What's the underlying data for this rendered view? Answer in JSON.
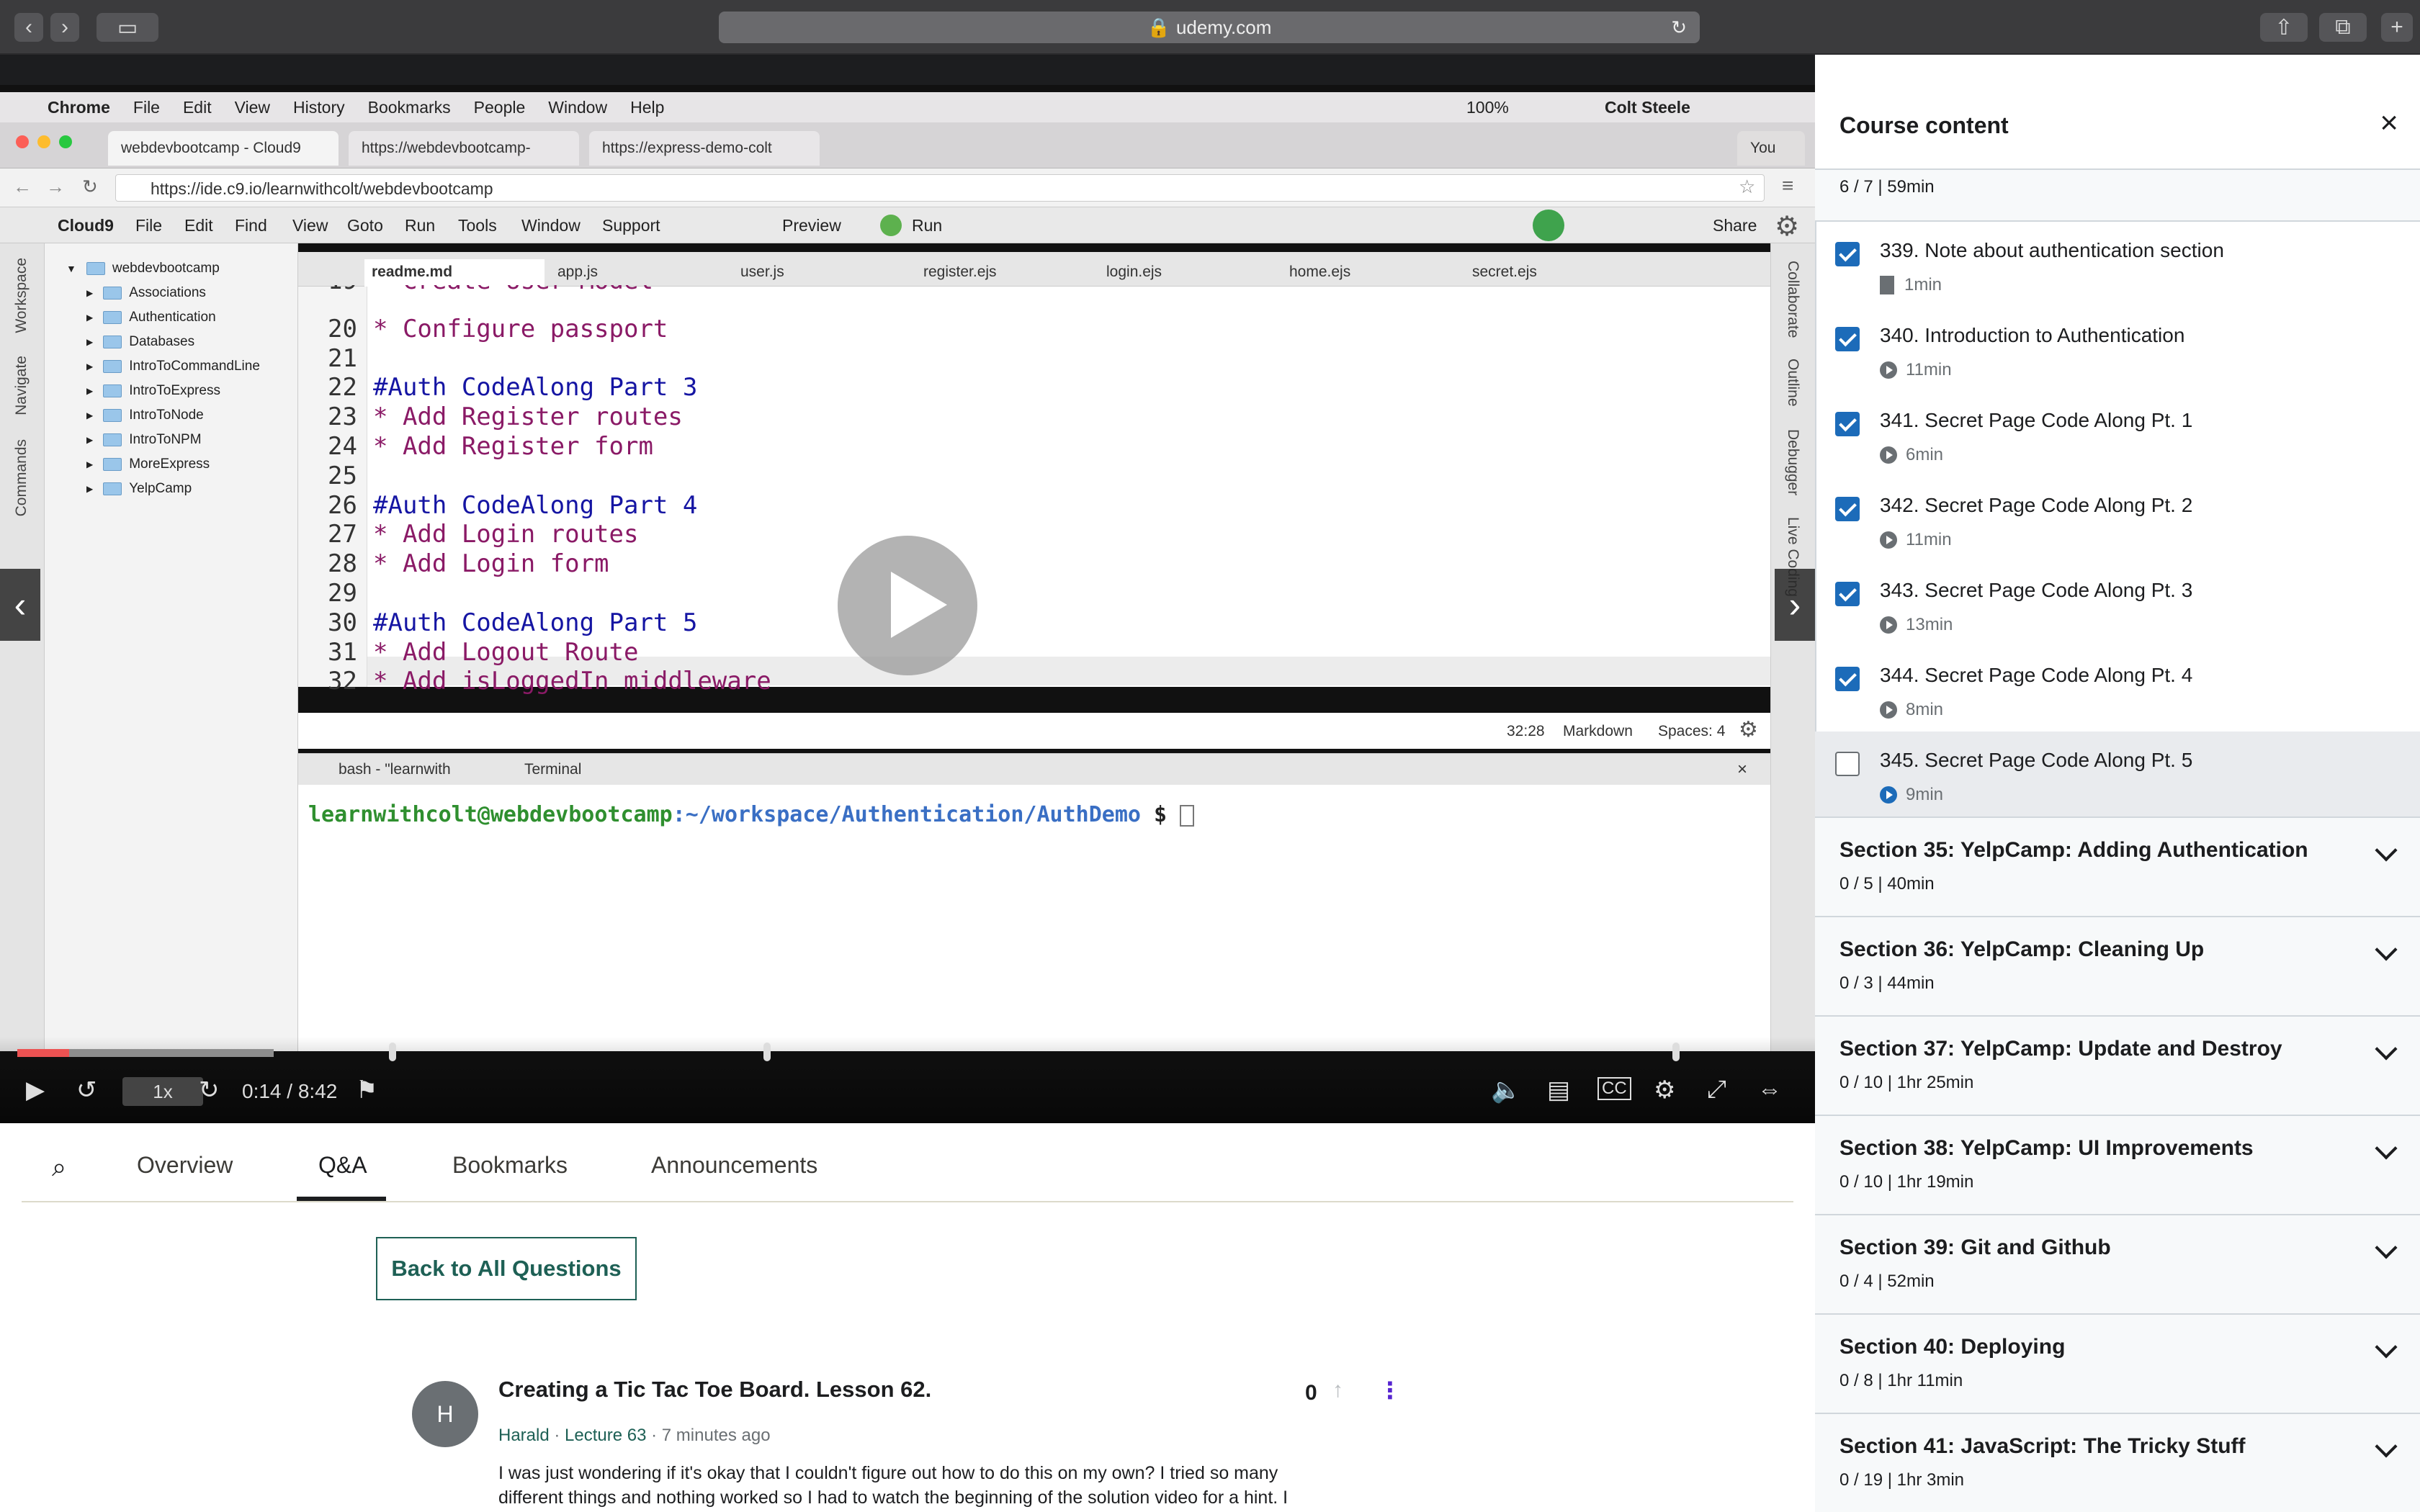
{
  "browser": {
    "url": "udemy.com"
  },
  "video": {
    "mac_menu": {
      "app": "Chrome",
      "items": [
        "File",
        "Edit",
        "View",
        "History",
        "Bookmarks",
        "People",
        "Window",
        "Help"
      ],
      "battery": "100%",
      "user": "Colt Steele"
    },
    "chrome_tabs": [
      "webdevbootcamp - Cloud9",
      "https://webdevbootcamp-",
      "https://express-demo-colt"
    ],
    "chrome_you": "You",
    "address": "https://ide.c9.io/learnwithcolt/webdevbootcamp",
    "cloud9_menu": {
      "brand": "Cloud9",
      "items": [
        "File",
        "Edit",
        "Find",
        "View",
        "Goto",
        "Run",
        "Tools",
        "Window",
        "Support"
      ],
      "preview": "Preview",
      "run": "Run",
      "share": "Share"
    },
    "left_panels": [
      "Workspace",
      "Navigate",
      "Commands"
    ],
    "right_panels": [
      "Collaborate",
      "Outline",
      "Debugger",
      "Live Coding"
    ],
    "file_tree": {
      "root": "webdevbootcamp",
      "folders": [
        "Associations",
        "Authentication",
        "Databases",
        "IntroToCommandLine",
        "IntroToExpress",
        "IntroToNode",
        "IntroToNPM",
        "MoreExpress",
        "YelpCamp"
      ]
    },
    "editor_tabs": [
      "readme.md",
      "app.js",
      "user.js",
      "register.ejs",
      "login.ejs",
      "home.ejs",
      "secret.ejs"
    ],
    "code_lines": [
      {
        "n": "19",
        "text": "* Create User Model",
        "kind": "b"
      },
      {
        "n": "20",
        "text": "* Configure passport",
        "kind": "b"
      },
      {
        "n": "21",
        "text": "",
        "kind": "b"
      },
      {
        "n": "22",
        "text": "#Auth CodeAlong Part 3",
        "kind": "h"
      },
      {
        "n": "23",
        "text": "* Add Register routes",
        "kind": "b"
      },
      {
        "n": "24",
        "text": "* Add Register form",
        "kind": "b"
      },
      {
        "n": "25",
        "text": "",
        "kind": "b"
      },
      {
        "n": "26",
        "text": "#Auth CodeAlong Part 4",
        "kind": "h"
      },
      {
        "n": "27",
        "text": "* Add Login routes",
        "kind": "b"
      },
      {
        "n": "28",
        "text": "* Add Login form",
        "kind": "b"
      },
      {
        "n": "29",
        "text": "",
        "kind": "b"
      },
      {
        "n": "30",
        "text": "#Auth CodeAlong Part 5",
        "kind": "h"
      },
      {
        "n": "31",
        "text": "* Add Logout Route",
        "kind": "b"
      },
      {
        "n": "32",
        "text": "* Add isLoggedIn middleware",
        "kind": "b"
      }
    ],
    "status": {
      "position": "32:28",
      "mode": "Markdown",
      "spaces": "Spaces: 4"
    },
    "terminal_tabs": [
      "bash - \"learnwith",
      "Terminal"
    ],
    "terminal": {
      "prompt_user": "learnwithcolt@webdevbootcamp",
      "prompt_path": ":~/workspace/Authentication/AuthDemo",
      "prompt_symbol": "$"
    },
    "player": {
      "speed": "1x",
      "time": "0:14 / 8:42",
      "progress_fraction": 0.019
    }
  },
  "tabs": {
    "items": [
      "Overview",
      "Q&A",
      "Bookmarks",
      "Announcements"
    ],
    "active": "Q&A"
  },
  "qa": {
    "back_button": "Back to All Questions",
    "question": {
      "avatar_letter": "H",
      "title": "Creating a Tic Tac Toe Board. Lesson 62.",
      "author": "Harald",
      "lecture": "Lecture 63",
      "time": "7 minutes ago",
      "votes": "0",
      "body_line1": "I was just wondering if it's okay that I couldn't figure out how to do this on my own? I tried so many",
      "body_line2": "different things and nothing worked so I had to watch the beginning of the solution video for a hint. I"
    }
  },
  "sidebar": {
    "title": "Course content",
    "prev_section_meta": "6 / 7 | 59min",
    "lectures": [
      {
        "title": "339. Note about authentication section",
        "duration": "1min",
        "done": true,
        "type": "doc"
      },
      {
        "title": "340. Introduction to Authentication",
        "duration": "11min",
        "done": true,
        "type": "video"
      },
      {
        "title": "341. Secret Page Code Along Pt. 1",
        "duration": "6min",
        "done": true,
        "type": "video"
      },
      {
        "title": "342. Secret Page Code Along Pt. 2",
        "duration": "11min",
        "done": true,
        "type": "video"
      },
      {
        "title": "343. Secret Page Code Along Pt. 3",
        "duration": "13min",
        "done": true,
        "type": "video"
      },
      {
        "title": "344. Secret Page Code Along Pt. 4",
        "duration": "8min",
        "done": true,
        "type": "video"
      },
      {
        "title": "345. Secret Page Code Along Pt. 5",
        "duration": "9min",
        "done": false,
        "type": "video",
        "current": true
      }
    ],
    "sections": [
      {
        "title": "Section 35: YelpCamp: Adding Authentication",
        "meta": "0 / 5 | 40min"
      },
      {
        "title": "Section 36: YelpCamp: Cleaning Up",
        "meta": "0 / 3 | 44min"
      },
      {
        "title": "Section 37: YelpCamp: Update and Destroy",
        "meta": "0 / 10 | 1hr 25min"
      },
      {
        "title": "Section 38: YelpCamp: UI Improvements",
        "meta": "0 / 10 | 1hr 19min"
      },
      {
        "title": "Section 39: Git and Github",
        "meta": "0 / 4 | 52min"
      },
      {
        "title": "Section 40: Deploying",
        "meta": "0 / 8 | 1hr 11min"
      },
      {
        "title": "Section 41: JavaScript: The Tricky Stuff",
        "meta": "0 / 19 | 1hr 3min"
      }
    ]
  }
}
